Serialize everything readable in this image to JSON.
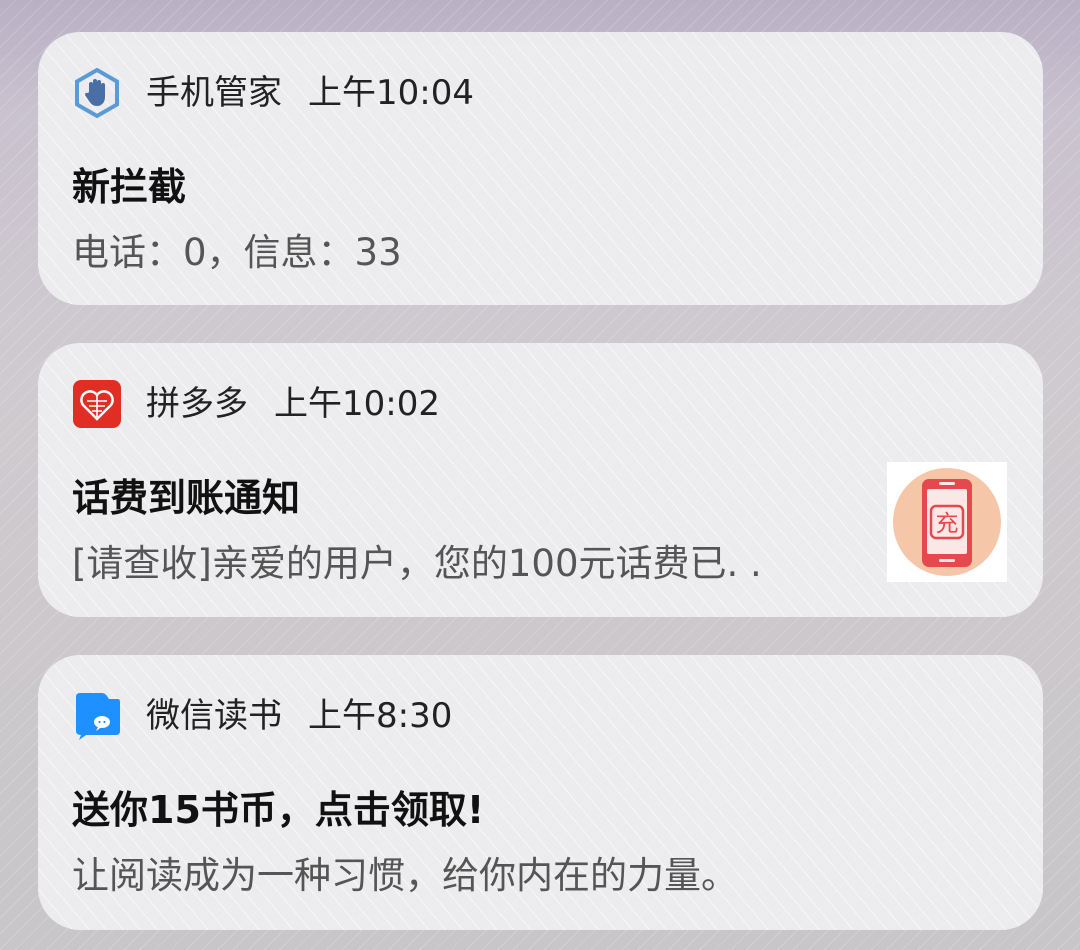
{
  "notifications": [
    {
      "app_name": "手机管家",
      "time": "上午10:04",
      "title": "新拦截",
      "body": "电话：0，信息：33",
      "icon": "phone-manager-hand-icon",
      "icon_color": "#4a90d9"
    },
    {
      "app_name": "拼多多",
      "time": "上午10:02",
      "title": "话费到账通知",
      "body": "[请查收]亲爱的用户，您的100元话费已. .",
      "icon": "pinduoduo-icon",
      "icon_color": "#e02e24",
      "thumbnail": {
        "icon": "phone-recharge-icon",
        "label": "充",
        "circle_color": "#f5c7a8",
        "accent_color": "#e5484d"
      }
    },
    {
      "app_name": "微信读书",
      "time": "上午8:30",
      "title": "送你15书币，点击领取!",
      "body": "让阅读成为一种习惯，给你内在的力量。",
      "icon": "wechat-read-icon",
      "icon_color": "#1e90ff"
    }
  ]
}
